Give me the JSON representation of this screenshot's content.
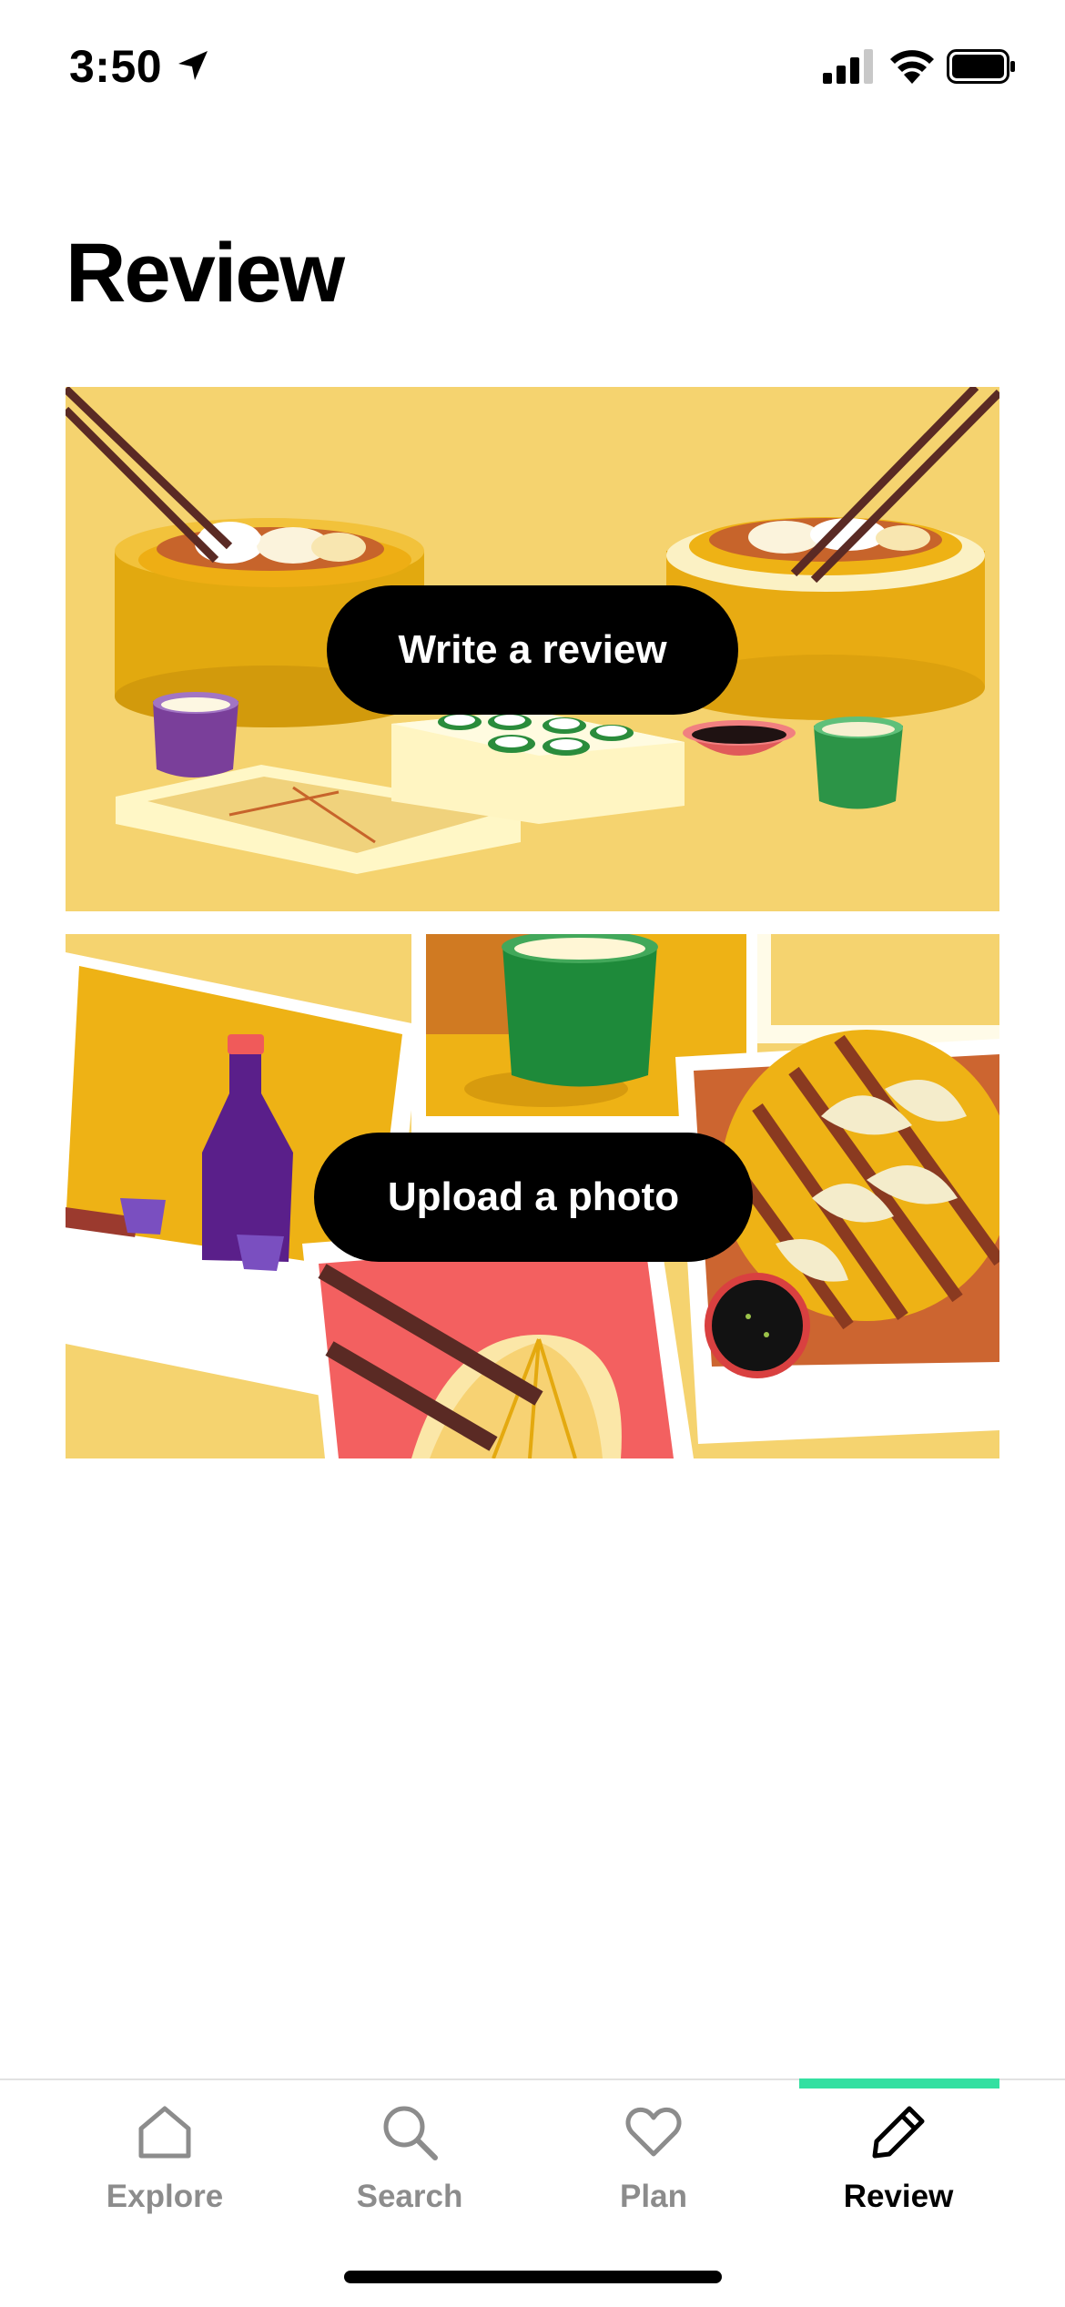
{
  "status_bar": {
    "time": "3:50",
    "icons": [
      "location-arrow-icon",
      "cellular-signal-icon",
      "wifi-icon",
      "battery-icon"
    ]
  },
  "page": {
    "title": "Review"
  },
  "cards": {
    "write_review": {
      "label": "Write a review",
      "illustration": "dim-sum-table-illustration"
    },
    "upload_photo": {
      "label": "Upload a photo",
      "illustration": "food-polaroids-illustration"
    }
  },
  "tab_bar": {
    "active_color": "#34e0a1",
    "items": [
      {
        "label": "Explore",
        "icon": "home-icon",
        "active": false
      },
      {
        "label": "Search",
        "icon": "search-icon",
        "active": false
      },
      {
        "label": "Plan",
        "icon": "heart-icon",
        "active": false
      },
      {
        "label": "Review",
        "icon": "pencil-icon",
        "active": true
      }
    ]
  },
  "colors": {
    "button_bg": "#000000",
    "button_text": "#ffffff",
    "card_bg": "#f5d36f"
  }
}
